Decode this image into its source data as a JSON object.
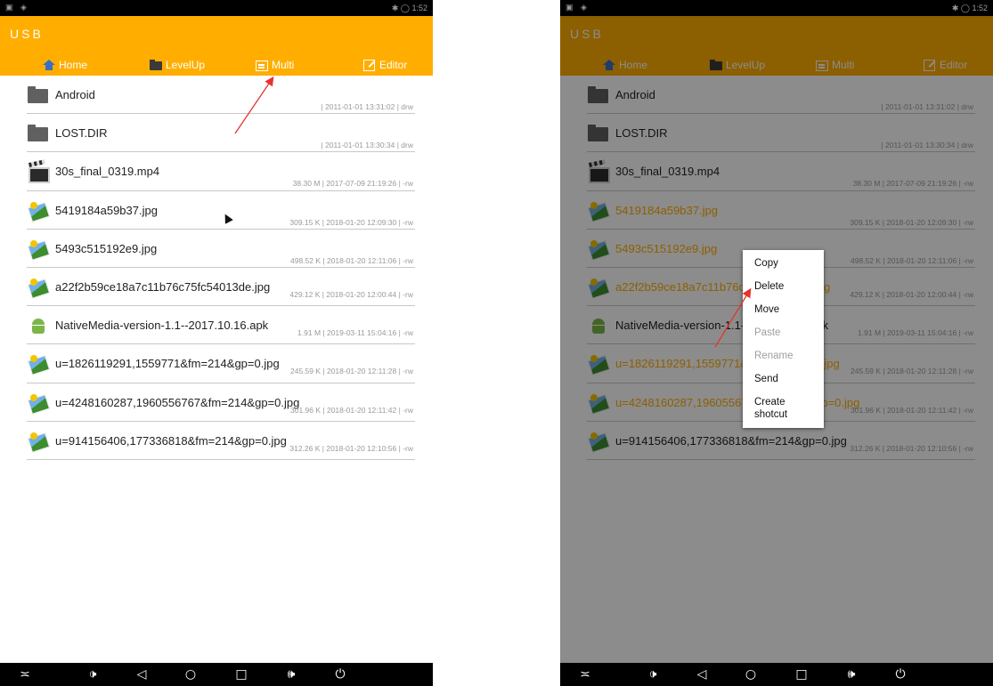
{
  "app": {
    "title": "USB"
  },
  "status": {
    "left": "▣ ◈",
    "right": "✱ ◯ 1:52"
  },
  "toolbar": {
    "home": "Home",
    "levelup": "LevelUp",
    "multi": "Multi",
    "editor": "Editor"
  },
  "files": [
    {
      "name": "Android",
      "meta": "| 2011-01-01 13:31:02 | drw",
      "icon": "folder-icon"
    },
    {
      "name": "LOST.DIR",
      "meta": "| 2011-01-01 13:30:34 | drw",
      "icon": "folder-icon"
    },
    {
      "name": "30s_final_0319.mp4",
      "meta": "38.30 M | 2017-07-09 21:19:26 | -rw",
      "icon": "video-icon"
    },
    {
      "name": "5419184a59b37.jpg",
      "meta": "309.15 K | 2018-01-20 12:09:30 | -rw",
      "icon": "image-icon"
    },
    {
      "name": "5493c515192e9.jpg",
      "meta": "498.52 K | 2018-01-20 12:11:06 | -rw",
      "icon": "image-icon"
    },
    {
      "name": "a22f2b59ce18a7c11b76c75fc54013de.jpg",
      "meta": "429.12 K | 2018-01-20 12:00:44 | -rw",
      "icon": "image-icon"
    },
    {
      "name": "NativeMedia-version-1.1--2017.10.16.apk",
      "meta": "1.91 M | 2019-03-11 15:04:16 | -rw",
      "icon": "apk-icon"
    },
    {
      "name": "u=1826119291,1559771&fm=214&gp=0.jpg",
      "meta": "245.59 K | 2018-01-20 12:11:28 | -rw",
      "icon": "image-icon"
    },
    {
      "name": "u=4248160287,1960556767&fm=214&gp=0.jpg",
      "meta": "301.96 K | 2018-01-20 12:11:42 | -rw",
      "icon": "image-icon"
    },
    {
      "name": "u=914156406,177336818&fm=214&gp=0.jpg",
      "meta": "312.26 K | 2018-01-20 12:10:56 | -rw",
      "icon": "image-icon"
    }
  ],
  "context_menu": {
    "items": [
      {
        "label": "Copy",
        "enabled": true
      },
      {
        "label": "Delete",
        "enabled": true
      },
      {
        "label": "Move",
        "enabled": true
      },
      {
        "label": "Paste",
        "enabled": false
      },
      {
        "label": "Rename",
        "enabled": false
      },
      {
        "label": "Send",
        "enabled": true
      },
      {
        "label": "Create\nshotcut",
        "enabled": true
      }
    ]
  },
  "navbar": [
    {
      "icon": "collapse-icon",
      "glyph": "≍"
    },
    {
      "icon": "volume-down-icon",
      "glyph": "🕩"
    },
    {
      "icon": "back-icon",
      "glyph": "◁"
    },
    {
      "icon": "home-circle-icon",
      "glyph": "○"
    },
    {
      "icon": "recents-icon",
      "glyph": "□"
    },
    {
      "icon": "volume-up-icon",
      "glyph": "🕪"
    },
    {
      "icon": "power-icon",
      "glyph": "⏻"
    }
  ],
  "colors": {
    "accent": "#ffae00",
    "annotation_arrow": "#e8322e",
    "dim_overlay": "rgba(0,0,0,0.45)"
  }
}
